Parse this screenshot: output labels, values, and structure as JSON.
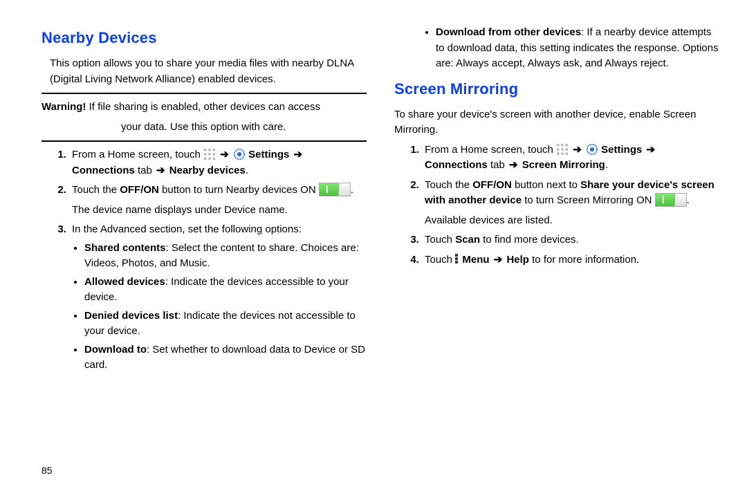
{
  "page_number": "85",
  "left": {
    "heading": "Nearby Devices",
    "intro": "This option allows you to share your media files with nearby DLNA (Digital Living Network Alliance) enabled devices.",
    "warning_label": "Warning!",
    "warning_text_1": " If file sharing is enabled, other devices can access",
    "warning_text_2": "your data. Use this option with care.",
    "step1_pre": "From a Home screen, touch ",
    "arrow": "➔",
    "step1_settings": " Settings ",
    "step1_conn": "Connections",
    "step1_tab": " tab ",
    "step1_nearby": " Nearby devices",
    "step2_a": "Touch the ",
    "step2_offon": "OFF/ON",
    "step2_b": " button to turn Nearby devices ON ",
    "step2_c": ".",
    "step2_extra": "The device name displays under Device name.",
    "step3_intro": "In the Advanced section, set the following options:",
    "bullets": {
      "b1_label": "Shared contents",
      "b1_text": ": Select the content to share. Choices are: Videos, Photos, and Music.",
      "b2_label": "Allowed devices",
      "b2_text": ": Indicate the devices accessible to your device.",
      "b3_label": "Denied devices list",
      "b3_text": ": Indicate the devices not accessible to your device.",
      "b4_label": "Download to",
      "b4_text": ": Set whether to download data to Device or SD card."
    }
  },
  "right": {
    "bullet_label": "Download from other devices",
    "bullet_text": ": If a nearby device attempts to download data, this setting indicates the response. Options are: Always accept, Always ask, and Always reject.",
    "heading": "Screen Mirroring",
    "intro": "To share your device's screen with another device, enable Screen Mirroring.",
    "step1_pre": "From a Home screen, touch ",
    "arrow": "➔",
    "step1_settings": " Settings ",
    "step1_conn": "Connections",
    "step1_tab": " tab ",
    "step1_sm": " Screen Mirroring",
    "step2_a": "Touch the ",
    "step2_offon": "OFF/ON",
    "step2_b": " button next to ",
    "step2_share": "Share your device's screen with another device",
    "step2_c": " to turn Screen Mirroring ON ",
    "step2_d": ".",
    "step2_extra": "Available devices are listed.",
    "step3_a": "Touch ",
    "step3_scan": "Scan",
    "step3_b": " to find more devices.",
    "step4_a": "Touch ",
    "step4_menu": " Menu ",
    "step4_help": " Help",
    "step4_b": " to for more information."
  }
}
